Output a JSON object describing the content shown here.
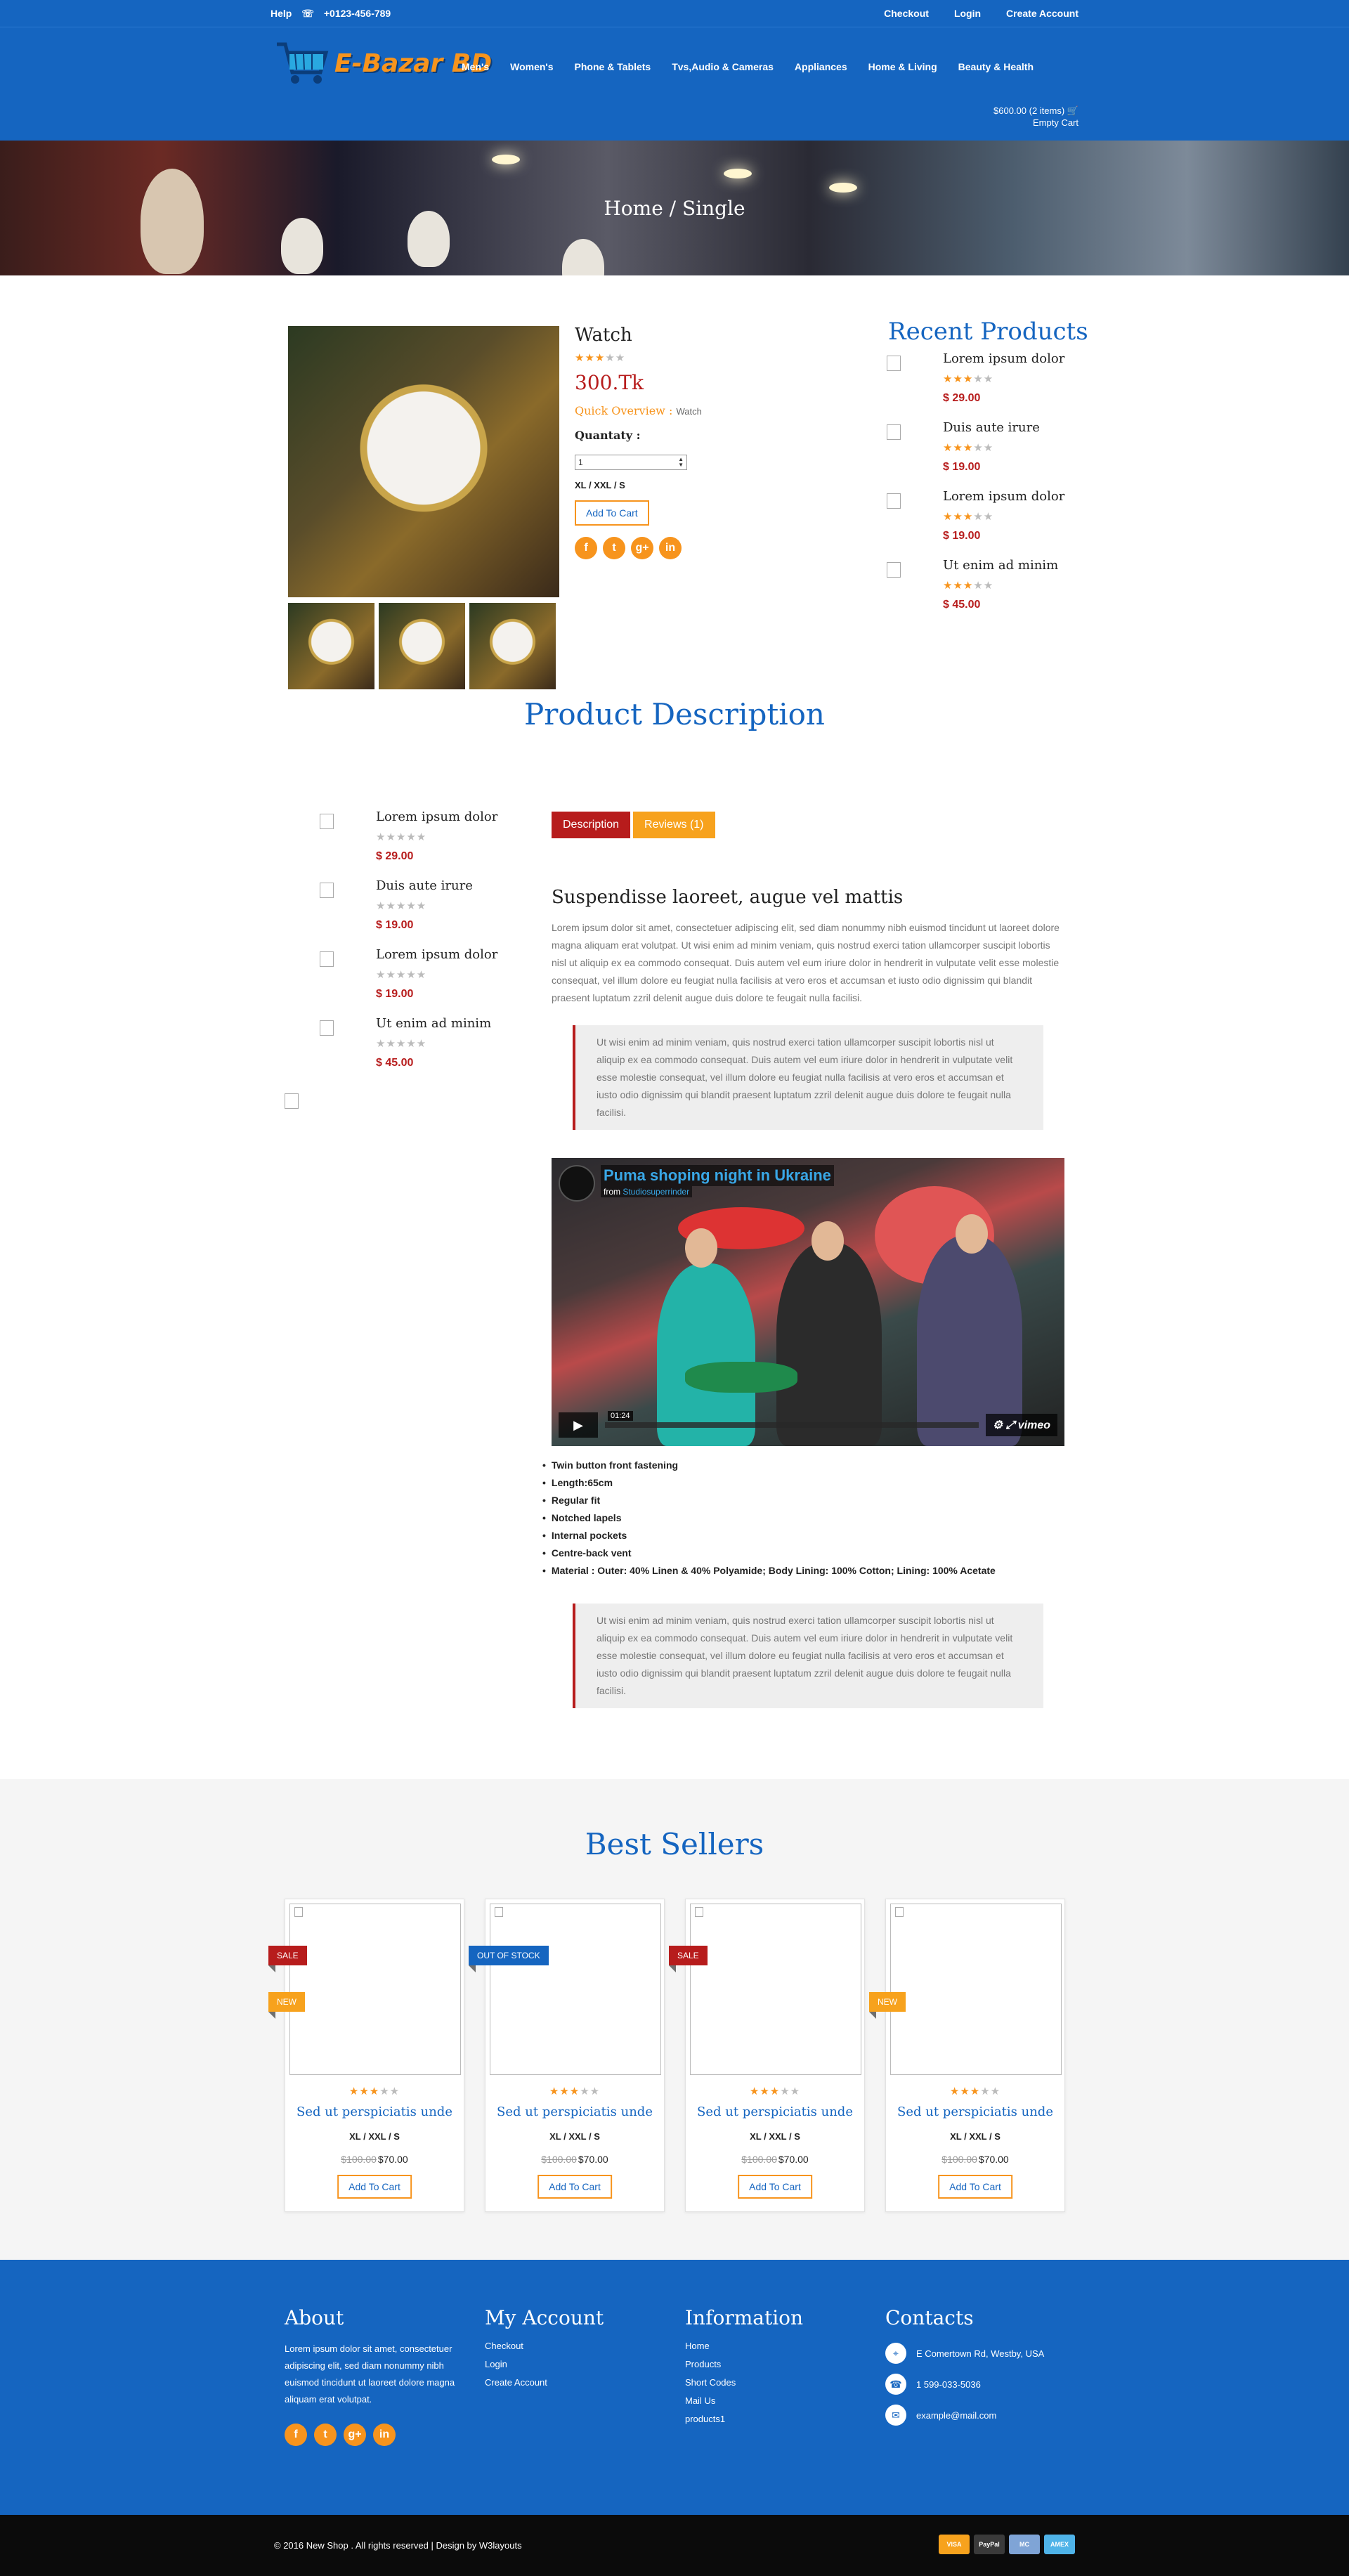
{
  "topbar": {
    "help": "Help",
    "phone": "+0123-456-789",
    "links": [
      "Checkout",
      "Login",
      "Create Account"
    ]
  },
  "header": {
    "logo_text": "E-Bazar BD",
    "nav": [
      "Men's",
      "Women's",
      "Phone & Tablets",
      "Tvs,Audio & Cameras",
      "Appliances",
      "Home & Living",
      "Beauty & Health"
    ],
    "cart_total": "$600.00 (2 items)",
    "cart_empty": "Empty Cart"
  },
  "banner": {
    "breadcrumb": "Home / Single"
  },
  "product": {
    "title": "Watch",
    "rating": 3,
    "price": "300.Tk",
    "quick_overview_label": "Quick Overview :",
    "quick_overview_value": "Watch",
    "quantity_label": "Quantaty :",
    "quantity_value": "1",
    "sizes": "XL / XXL / S",
    "add_to_cart": "Add To Cart",
    "social": [
      "f",
      "t",
      "g+",
      "in"
    ]
  },
  "recent": {
    "title": "Recent Products",
    "items": [
      {
        "name": "Lorem ipsum dolor",
        "rating": 3,
        "price": "$ 29.00"
      },
      {
        "name": "Duis aute irure",
        "rating": 3,
        "price": "$ 19.00"
      },
      {
        "name": "Lorem ipsum dolor",
        "rating": 3,
        "price": "$ 19.00"
      },
      {
        "name": "Ut enim ad minim",
        "rating": 3,
        "price": "$ 45.00"
      }
    ]
  },
  "description": {
    "title": "Product Description",
    "side_items": [
      {
        "name": "Lorem ipsum dolor",
        "rating": 0,
        "price": "$ 29.00"
      },
      {
        "name": "Duis aute irure",
        "rating": 0,
        "price": "$ 19.00"
      },
      {
        "name": "Lorem ipsum dolor",
        "rating": 0,
        "price": "$ 19.00"
      },
      {
        "name": "Ut enim ad minim",
        "rating": 0,
        "price": "$ 45.00"
      }
    ],
    "tabs": [
      "Description",
      "Reviews (1)"
    ],
    "heading": "Suspendisse laoreet, augue vel mattis",
    "body": "Lorem ipsum dolor sit amet, consectetuer adipiscing elit, sed diam nonummy nibh euismod tincidunt ut laoreet dolore magna aliquam erat volutpat. Ut wisi enim ad minim veniam, quis nostrud exerci tation ullamcorper suscipit lobortis nisl ut aliquip ex ea commodo consequat. Duis autem vel eum iriure dolor in hendrerit in vulputate velit esse molestie consequat, vel illum dolore eu feugiat nulla facilisis at vero eros et accumsan et iusto odio dignissim qui blandit praesent luptatum zzril delenit augue duis dolore te feugait nulla facilisi.",
    "quote1": "Ut wisi enim ad minim veniam, quis nostrud exerci tation ullamcorper suscipit lobortis nisl ut aliquip ex ea commodo consequat. Duis autem vel eum iriure dolor in hendrerit in vulputate velit esse molestie consequat, vel illum dolore eu feugiat nulla facilisis at vero eros et accumsan et iusto odio dignissim qui blandit praesent luptatum zzril delenit augue duis dolore te feugait nulla facilisi.",
    "video_title": "Puma shoping night in Ukraine",
    "video_from_label": "from",
    "video_author": "Studiosuperrinder",
    "video_time": "01:24",
    "video_brand": "vimeo",
    "features": [
      "Twin button front fastening",
      "Length:65cm",
      "Regular fit",
      "Notched lapels",
      "Internal pockets",
      "Centre-back vent",
      "Material : Outer: 40% Linen & 40% Polyamide; Body Lining: 100% Cotton; Lining: 100% Acetate"
    ],
    "quote2": "Ut wisi enim ad minim veniam, quis nostrud exerci tation ullamcorper suscipit lobortis nisl ut aliquip ex ea commodo consequat. Duis autem vel eum iriure dolor in hendrerit in vulputate velit esse molestie consequat, vel illum dolore eu feugiat nulla facilisis at vero eros et accumsan et iusto odio dignissim qui blandit praesent luptatum zzril delenit augue duis dolore te feugait nulla facilisi."
  },
  "best_sellers": {
    "title": "Best Sellers",
    "cards": [
      {
        "tags": [
          "SALE",
          "NEW"
        ],
        "rating": 3,
        "title": "Sed ut perspiciatis unde",
        "sizes": "XL / XXL / S",
        "old_price": "$100.00",
        "price": "$70.00",
        "button": "Add To Cart"
      },
      {
        "tags": [
          "OUT OF STOCK"
        ],
        "rating": 3,
        "title": "Sed ut perspiciatis unde",
        "sizes": "XL / XXL / S",
        "old_price": "$100.00",
        "price": "$70.00",
        "button": "Add To Cart"
      },
      {
        "tags": [
          "SALE"
        ],
        "rating": 3,
        "title": "Sed ut perspiciatis unde",
        "sizes": "XL / XXL / S",
        "old_price": "$100.00",
        "price": "$70.00",
        "button": "Add To Cart"
      },
      {
        "tags": [
          "NEW"
        ],
        "rating": 3,
        "title": "Sed ut perspiciatis unde",
        "sizes": "XL / XXL / S",
        "old_price": "$100.00",
        "price": "$70.00",
        "button": "Add To Cart"
      }
    ]
  },
  "footer": {
    "about_title": "About",
    "about_text": "Lorem ipsum dolor sit amet, consectetuer adipiscing elit, sed diam nonummy nibh euismod tincidunt ut laoreet dolore magna aliquam erat volutpat.",
    "account_title": "My Account",
    "account_links": [
      "Checkout",
      "Login",
      "Create Account"
    ],
    "info_title": "Information",
    "info_links": [
      "Home",
      "Products",
      "Short Codes",
      "Mail Us",
      "products1"
    ],
    "contacts_title": "Contacts",
    "address": "E Comertown Rd, Westby, USA",
    "phone": "1 599-033-5036",
    "email": "example@mail.com"
  },
  "copyright": {
    "text": "© 2016 New Shop . All rights reserved | Design by",
    "designer": "W3layouts",
    "payments": [
      "VISA",
      "PayPal",
      "MC",
      "AMEX"
    ]
  },
  "colors": {
    "primary": "#1565c0",
    "accent": "#f7941d",
    "price": "#b71c1c"
  }
}
